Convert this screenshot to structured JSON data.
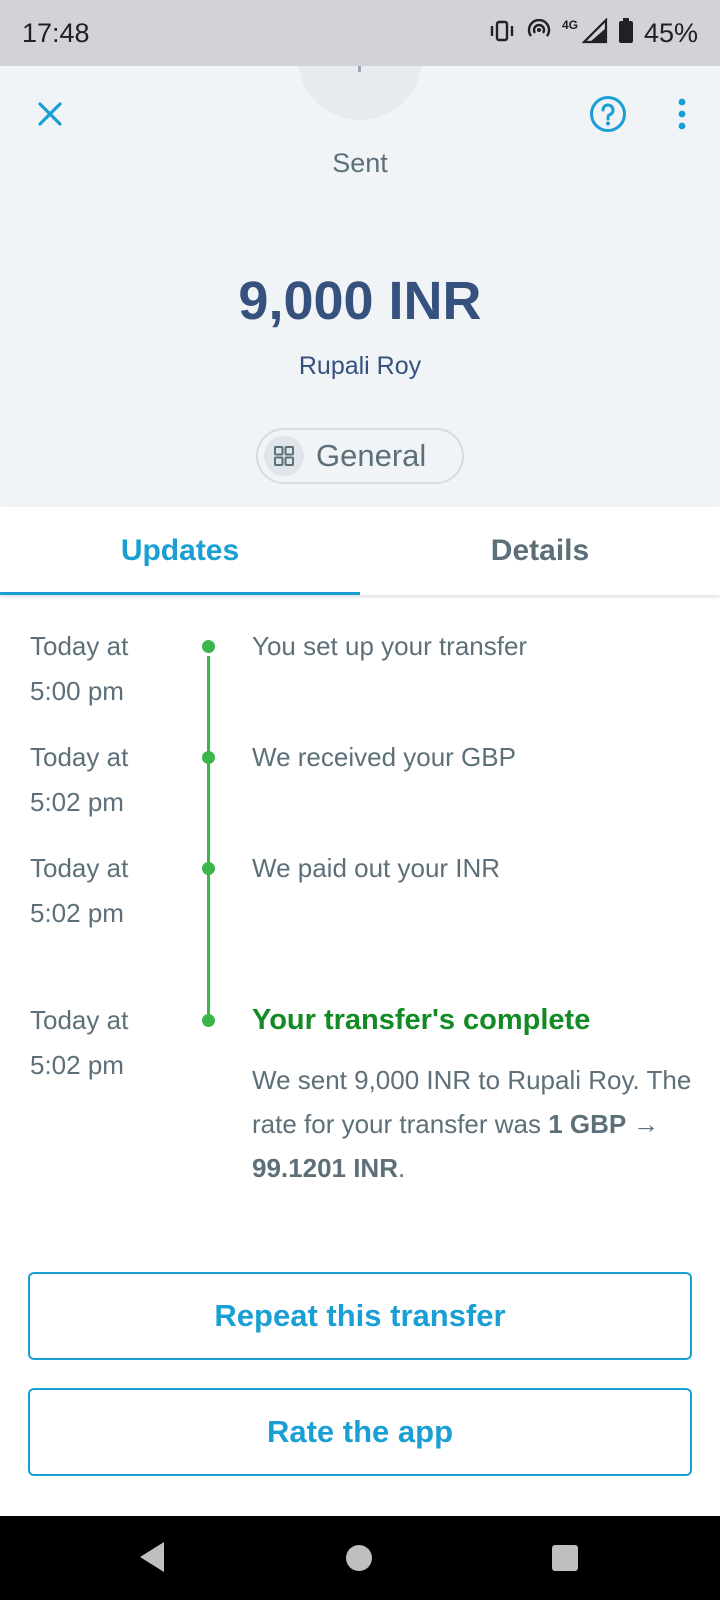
{
  "status_bar": {
    "time": "17:48",
    "network": "4G",
    "battery": "45%"
  },
  "header": {
    "status": "Sent",
    "amount": "9,000 INR",
    "recipient": "Rupali Roy",
    "category": "General"
  },
  "tabs": [
    {
      "label": "Updates",
      "active": true
    },
    {
      "label": "Details",
      "active": false
    }
  ],
  "timeline": [
    {
      "time_line1": "Today at",
      "time_line2": "5:00 pm",
      "text": "You set up your transfer"
    },
    {
      "time_line1": "Today at",
      "time_line2": "5:02 pm",
      "text": "We received your GBP"
    },
    {
      "time_line1": "Today at",
      "time_line2": "5:02 pm",
      "text": "We paid out your INR"
    },
    {
      "time_line1": "Today at",
      "time_line2": "5:02 pm",
      "title": "Your transfer's complete",
      "body_prefix": "We sent 9,000 INR to Rupali Roy. The rate for your transfer was ",
      "body_rate": "1 GBP → 99.1201 INR",
      "body_suffix": "."
    }
  ],
  "buttons": {
    "repeat": "Repeat this transfer",
    "rate": "Rate the app"
  },
  "colors": {
    "accent": "#1a9fd4",
    "primary_text": "#37517e",
    "secondary_text": "#5d7079",
    "success": "#128b24",
    "timeline": "#3cb54a",
    "header_bg": "#f1f4f7"
  },
  "icons": {
    "close": "close-icon",
    "help": "help-circle-icon",
    "more": "more-vertical-icon",
    "category": "grid-icon",
    "vibrate": "vibrate-icon",
    "hotspot": "hotspot-icon",
    "signal": "signal-icon",
    "battery": "battery-icon"
  }
}
